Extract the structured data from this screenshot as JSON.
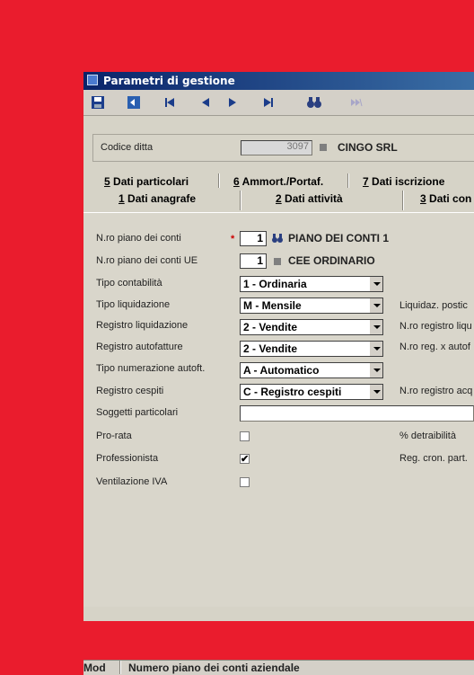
{
  "window": {
    "title": "Parametri di gestione"
  },
  "toolbar": {
    "icons": [
      "save-icon",
      "exit-icon",
      "first-icon",
      "prev-icon",
      "next-icon",
      "last-icon",
      "binoculars-icon",
      "skip-icon"
    ]
  },
  "company": {
    "label": "Codice ditta",
    "code": "3097",
    "name": "CINGO SRL"
  },
  "tabs": {
    "row1": [
      {
        "key": "5",
        "label": " Dati particolari"
      },
      {
        "key": "6",
        "label": " Ammort./Portaf."
      },
      {
        "key": "7",
        "label": " Dati iscrizione"
      }
    ],
    "row2": [
      {
        "key": "1",
        "label": " Dati anagrafe"
      },
      {
        "key": "2",
        "label": " Dati attività"
      },
      {
        "key": "3",
        "label": " Dati con"
      }
    ]
  },
  "form": {
    "piano_label": "N.ro piano dei conti",
    "piano_value": "1",
    "piano_name": "PIANO DEI CONTI 1",
    "required_marker": "*",
    "piano_ue_label": "N.ro piano dei conti UE",
    "piano_ue_value": "1",
    "piano_ue_name": "CEE ORDINARIO",
    "tipo_contabilita_label": "Tipo contabilità",
    "tipo_contabilita_value": "1  - Ordinaria",
    "tipo_liquidazione_label": "Tipo liquidazione",
    "tipo_liquidazione_value": "M  - Mensile",
    "registro_liquidazione_label": "Registro liquidazione",
    "registro_liquidazione_value": "2  - Vendite",
    "registro_autofatture_label": "Registro autofatture",
    "registro_autofatture_value": "2  - Vendite",
    "tipo_numerazione_label": "Tipo numerazione autoft.",
    "tipo_numerazione_value": "A  - Automatico",
    "registro_cespiti_label": "Registro cespiti",
    "registro_cespiti_value": "C  - Registro cespiti",
    "soggetti_label": "Soggetti particolari",
    "soggetti_value": "",
    "prorata_label": "Pro-rata",
    "prorata_checked": "",
    "professionista_label": "Professionista",
    "professionista_checked": "✔",
    "ventilazione_label": "Ventilazione IVA",
    "ventilazione_checked": "",
    "right_labels": {
      "liquidaz": "Liquidaz. postic",
      "registro_liq": "N.ro registro liqu",
      "reg_autof": "N.ro reg. x autof",
      "registro_acq": "N.ro registro acq",
      "detraibilita": "% detraibilità",
      "reg_cron": "Reg. cron. part."
    }
  },
  "status": {
    "mode": "Mod",
    "message": "Numero piano dei conti aziendale"
  }
}
